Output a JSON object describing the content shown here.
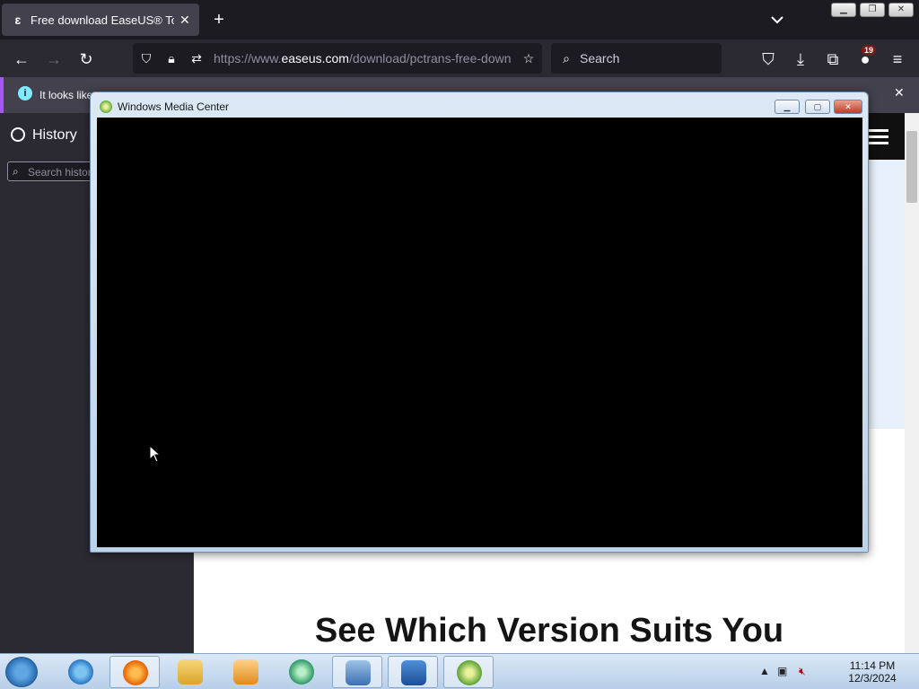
{
  "browser": {
    "tab_title": "Free download EaseUS® Todo P",
    "tab_favicon_text": "ɛ",
    "new_tab_label": "+",
    "url_prefix": "https://www.",
    "url_host": "easeus.com",
    "url_path": "/download/pctrans-free-down",
    "search_placeholder": "Search",
    "extension_badge": "19"
  },
  "notification": {
    "text": "It looks like"
  },
  "sidebar": {
    "title": "History",
    "search_placeholder": "Search histor"
  },
  "page": {
    "heading": "See Which Version Suits You"
  },
  "wmc_window": {
    "title": "Windows Media Center"
  },
  "taskbar": {
    "items": [
      "start",
      "internet-explorer",
      "firefox",
      "file-explorer",
      "media-player",
      "media-center-app",
      "remote-desktop",
      "pc-app",
      "windows-media-center"
    ],
    "time": "11:14 PM",
    "date": "12/3/2024"
  },
  "colors": {
    "brand_accent": "#a855f7",
    "wmc_frame": "#bcd2ea",
    "taskbar": "#b7cfe8"
  }
}
